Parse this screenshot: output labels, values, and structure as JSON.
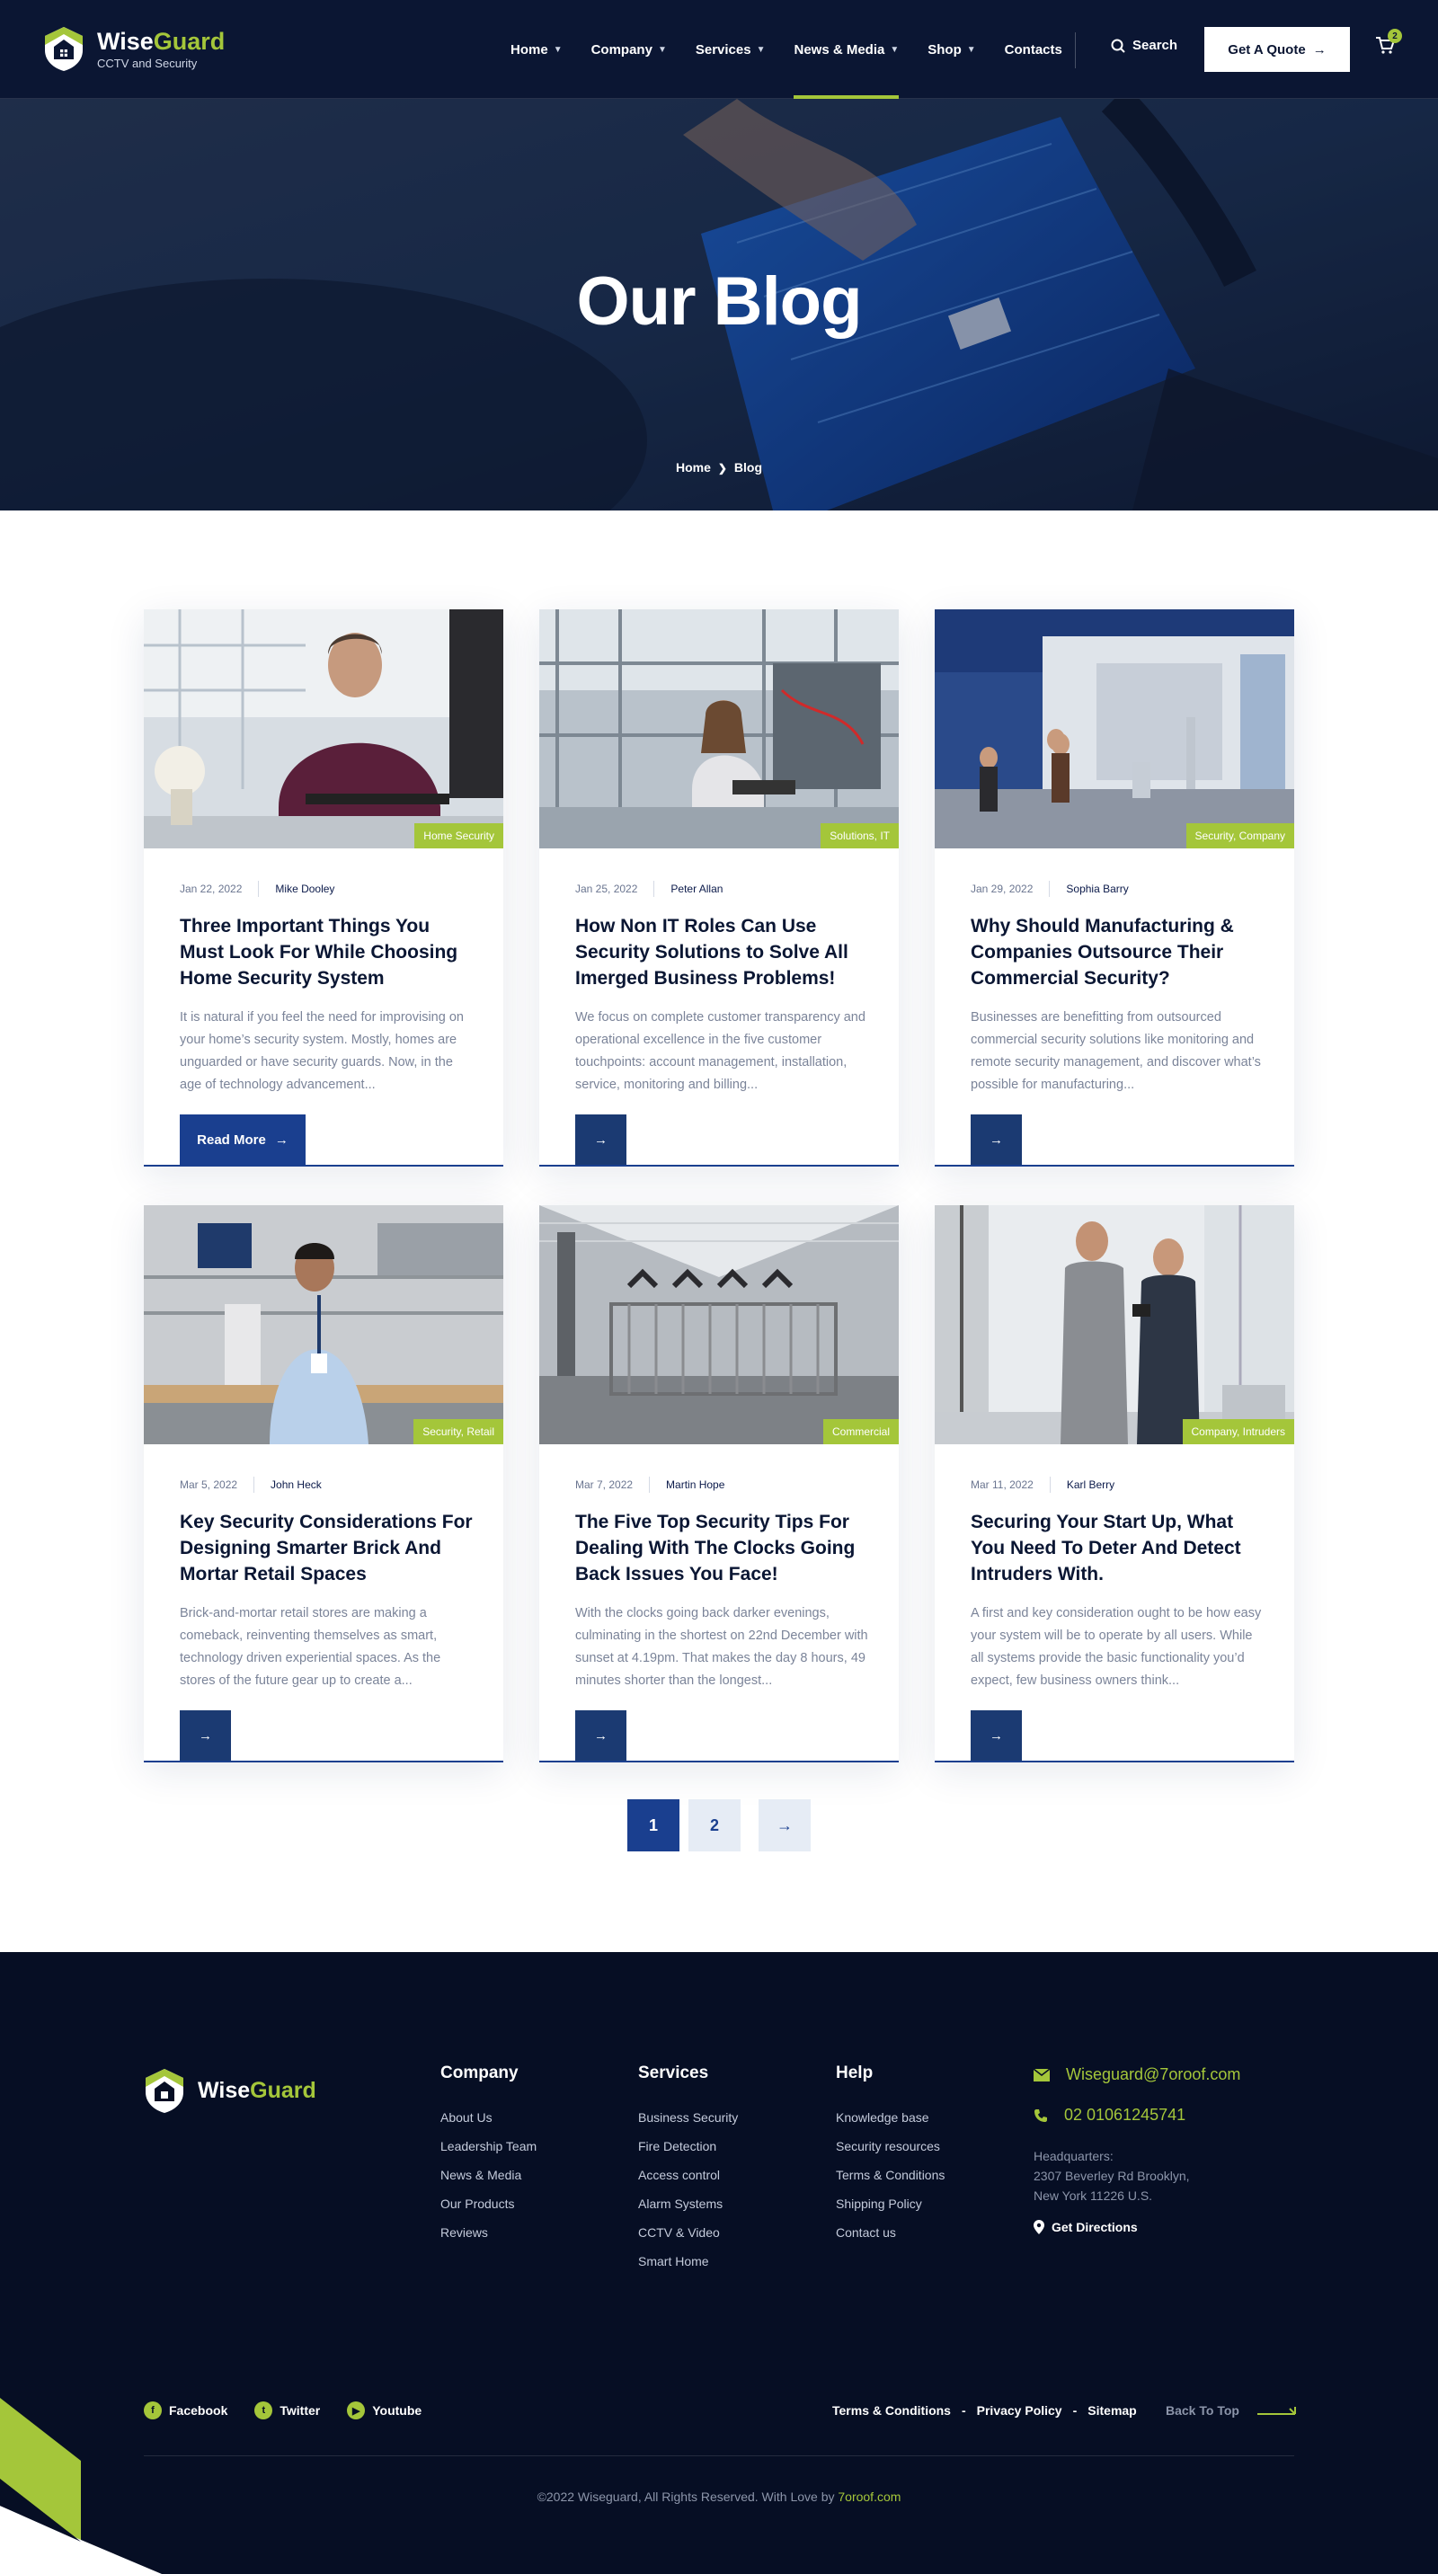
{
  "brand": {
    "name_a": "Wise",
    "name_b": "Guard",
    "tagline": "CCTV and Security"
  },
  "nav": {
    "items": [
      {
        "label": "Home",
        "dropdown": true
      },
      {
        "label": "Company",
        "dropdown": true
      },
      {
        "label": "Services",
        "dropdown": true
      },
      {
        "label": "News & Media",
        "dropdown": true,
        "active": true
      },
      {
        "label": "Shop",
        "dropdown": true
      },
      {
        "label": "Contacts",
        "dropdown": false
      }
    ],
    "search_label": "Search",
    "quote_label": "Get A Quote",
    "cart_count": "2"
  },
  "hero": {
    "title": "Our Blog",
    "crumb_home": "Home",
    "crumb_current": "Blog"
  },
  "posts": [
    {
      "date": "Jan 22, 2022",
      "author": "Mike Dooley",
      "tag": "Home Security",
      "title": "Three Important Things You Must Look For While Choosing Home Security System",
      "excerpt": "It is natural if you feel the need for improvising on your home’s security system. Mostly, homes are unguarded or have security guards. Now, in the age of technology advancement...",
      "button": "Read More"
    },
    {
      "date": "Jan 25, 2022",
      "author": "Peter Allan",
      "tag": "Solutions, IT",
      "title": "How Non IT Roles Can Use Security Solutions to Solve All Imerged Business Problems!",
      "excerpt": "We focus on complete customer transparency and operational excellence in the five customer touchpoints: account management, installation, service, monitoring and billing..."
    },
    {
      "date": "Jan 29, 2022",
      "author": "Sophia Barry",
      "tag": "Security, Company",
      "title": "Why Should Manufacturing & Companies Outsource Their Commercial Security?",
      "excerpt": "Businesses are benefitting from outsourced commercial security solutions like monitoring and remote security management, and discover what’s possible for manufacturing..."
    },
    {
      "date": "Mar 5, 2022",
      "author": "John Heck",
      "tag": "Security, Retail",
      "title": "Key Security Considerations For Designing Smarter Brick And Mortar Retail Spaces",
      "excerpt": "Brick-and-mortar retail stores are making a comeback, reinventing themselves as smart, technology driven experiential spaces. As the stores of the future gear up to create a..."
    },
    {
      "date": "Mar 7, 2022",
      "author": "Martin Hope",
      "tag": "Commercial",
      "title": "The Five Top Security Tips For Dealing With The Clocks Going Back Issues You Face!",
      "excerpt": "With the clocks going back darker evenings, culminating in the shortest on 22nd December with sunset at 4.19pm. That makes the day 8 hours, 49 minutes shorter than the longest..."
    },
    {
      "date": "Mar 11, 2022",
      "author": "Karl Berry",
      "tag": "Company, Intruders",
      "title": "Securing Your Start Up, What You Need To Deter And Detect Intruders With.",
      "excerpt": "A first and key consideration ought to be how easy your system will be to operate by all users. While all systems provide the basic functionality you’d expect, few business owners think..."
    }
  ],
  "pagination": {
    "pages": [
      "1",
      "2"
    ],
    "current": "1"
  },
  "footer": {
    "col_company": {
      "title": "Company",
      "links": [
        "About Us",
        "Leadership Team",
        "News & Media",
        "Our Products",
        "Reviews"
      ]
    },
    "col_services": {
      "title": "Services",
      "links": [
        "Business Security",
        "Fire Detection",
        "Access control",
        "Alarm Systems",
        "CCTV & Video",
        "Smart Home"
      ]
    },
    "col_help": {
      "title": "Help",
      "links": [
        "Knowledge base",
        "Security resources",
        "Terms & Conditions",
        "Shipping Policy",
        "Contact us"
      ]
    },
    "email": "Wiseguard@7oroof.com",
    "phone": "02 01061245741",
    "hq_label": "Headquarters:",
    "hq_line1": "2307 Beverley Rd Brooklyn,",
    "hq_line2": "New York 11226 U.S.",
    "directions": "Get Directions",
    "socials": [
      "Facebook",
      "Twitter",
      "Youtube"
    ],
    "legal": [
      "Terms & Conditions",
      "Privacy Policy",
      "Sitemap"
    ],
    "back_top": "Back To Top",
    "copyright": "©2022 Wiseguard, All Rights Reserved. With Love by ",
    "copyright_link": "7oroof.com"
  },
  "colors": {
    "navy": "#0b1633",
    "accent": "#a4c63a",
    "primary": "#1a3f8f",
    "footer_bg": "#060e24"
  }
}
